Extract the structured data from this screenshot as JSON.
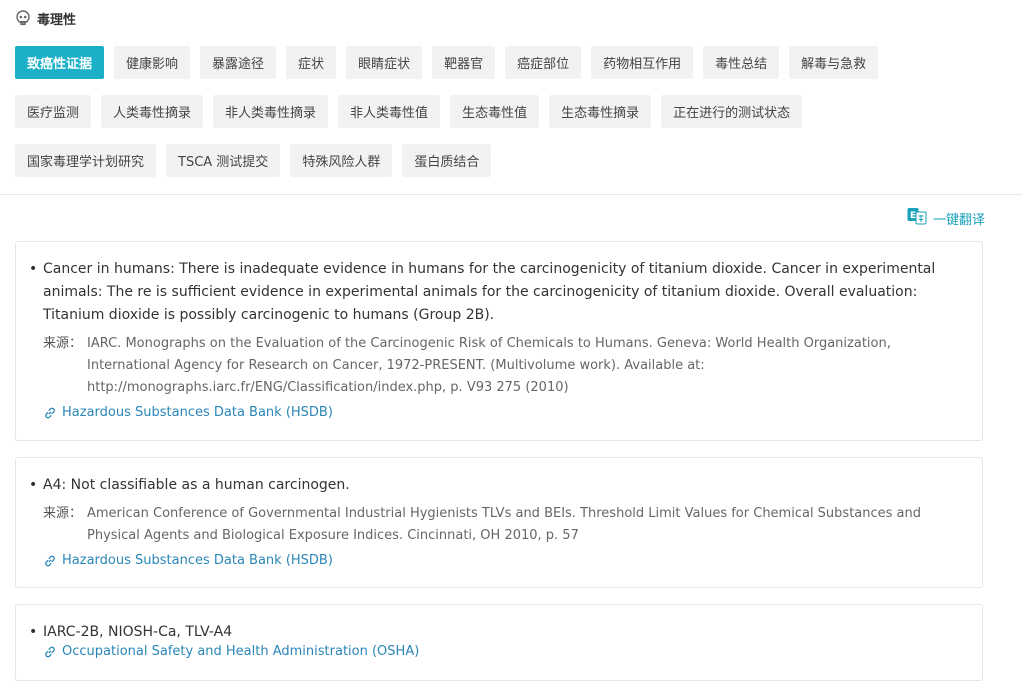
{
  "section": {
    "title": "毒理性",
    "icon": "skull-icon"
  },
  "tabs": [
    [
      "致癌性证据",
      "健康影响",
      "暴露途径",
      "症状",
      "眼睛症状",
      "靶器官",
      "癌症部位",
      "药物相互作用",
      "毒性总结",
      "解毒与急救"
    ],
    [
      "医疗监测",
      "人类毒性摘录",
      "非人类毒性摘录",
      "非人类毒性值",
      "生态毒性值",
      "生态毒性摘录",
      "正在进行的测试状态"
    ],
    [
      "国家毒理学计划研究",
      "TSCA 测试提交",
      "特殊风险人群",
      "蛋白质结合"
    ]
  ],
  "active_tab": "致癌性证据",
  "translate_label": "一键翻译",
  "source_label": "来源：",
  "records": [
    {
      "text": "Cancer in humans: There is inadequate evidence in humans for the carcinogenicity of titanium dioxide. Cancer in experimental animals: The re is sufficient evidence in experimental animals for the carcinogenicity of titanium dioxide. Overall evaluation: Titanium dioxide is possibly carcinogenic to humans (Group 2B).",
      "source": "IARC. Monographs on the Evaluation of the Carcinogenic Risk of Chemicals to Humans. Geneva: World Health Organization, International Agency for Research on Cancer, 1972-PRESENT. (Multivolume work). Available at: http://monographs.iarc.fr/ENG/Classification/index.php, p. V93 275 (2010)",
      "link": "Hazardous Substances Data Bank (HSDB)"
    },
    {
      "text": "A4: Not classifiable as a human carcinogen.",
      "source": "American Conference of Governmental Industrial Hygienists TLVs and BEIs. Threshold Limit Values for Chemical Substances and Physical Agents and Biological Exposure Indices. Cincinnati, OH 2010, p. 57",
      "link": "Hazardous Substances Data Bank (HSDB)"
    },
    {
      "text": "IARC-2B, NIOSH-Ca, TLV-A4",
      "source": "",
      "link": "Occupational Safety and Health Administration (OSHA)"
    }
  ],
  "colors": {
    "accent": "#1bb0c8",
    "link": "#2a86b8",
    "tab_bg": "#f2f2f2"
  }
}
